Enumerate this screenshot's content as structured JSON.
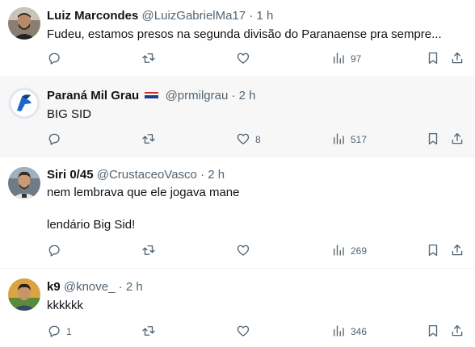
{
  "tweets": [
    {
      "name": "Luiz Marcondes",
      "handle": "@LuizGabrielMa17",
      "sep": "·",
      "time": "1 h",
      "text": "Fudeu, estamos presos na segunda divisão do Paranaense pra sempre...",
      "replies": "",
      "retweets": "",
      "likes": "",
      "views": "97",
      "flag": false
    },
    {
      "name": "Paraná Mil Grau",
      "handle": "@prmilgrau",
      "sep": "·",
      "time": "2 h",
      "text": "BIG SID",
      "replies": "",
      "retweets": "",
      "likes": "8",
      "views": "517",
      "flag": true
    },
    {
      "name": "Siri 0/45",
      "handle": "@CrustaceoVasco",
      "sep": "·",
      "time": "2 h",
      "text": "nem lembrava que ele jogava mane\n\nlendário Big Sid!",
      "replies": "",
      "retweets": "",
      "likes": "",
      "views": "269",
      "flag": false
    },
    {
      "name": "k9",
      "handle": "@knove_",
      "sep": "·",
      "time": "2 h",
      "text": "kkkkkk",
      "replies": "1",
      "retweets": "",
      "likes": "",
      "views": "346",
      "flag": false
    }
  ],
  "colors": {
    "text_primary": "#0f1419",
    "text_secondary": "#536471",
    "divider": "#eff3f4",
    "highlight_bg": "#f7f7f7",
    "flag_colors": [
      "#1a3f8f",
      "#ffffff",
      "#d22f27"
    ]
  },
  "icons": [
    "reply-icon",
    "retweet-icon",
    "like-icon",
    "views-icon",
    "bookmark-icon",
    "share-icon"
  ]
}
